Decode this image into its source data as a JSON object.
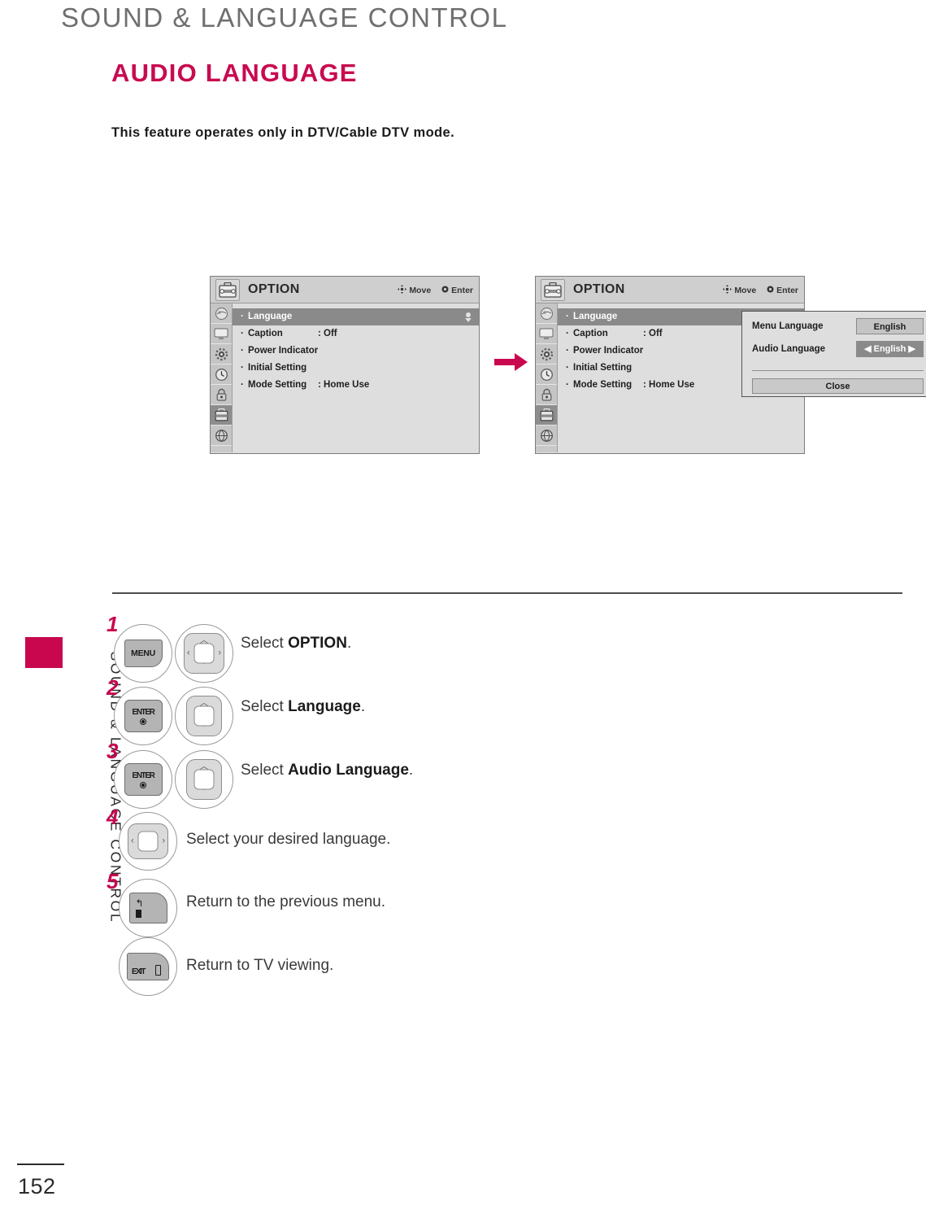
{
  "header": {
    "chapter_title": "SOUND & LANGUAGE CONTROL",
    "section_title": "AUDIO LANGUAGE",
    "intro": "This feature operates only in DTV/Cable DTV mode."
  },
  "side_tab": {
    "label": "SOUND & LANGUAGE CONTROL",
    "accent_color": "#c8074f"
  },
  "footer": {
    "page_number": "152"
  },
  "osd": {
    "title": "OPTION",
    "hints": {
      "move": "Move",
      "enter": "Enter"
    },
    "rail_icons": [
      "picture-icon",
      "screen-icon",
      "audio-gear-icon",
      "time-clock-icon",
      "lock-icon",
      "option-toolbox-icon",
      "network-globe-icon"
    ],
    "rail_active_index": 5,
    "menu_items": [
      {
        "label": "Language",
        "value": "",
        "selected": true,
        "scroll": true
      },
      {
        "label": "Caption",
        "value": ": Off",
        "selected": false,
        "scroll": false
      },
      {
        "label": "Power Indicator",
        "value": "",
        "selected": false,
        "scroll": false
      },
      {
        "label": "Initial Setting",
        "value": "",
        "selected": false,
        "scroll": false
      },
      {
        "label": "Mode Setting",
        "value": ": Home Use",
        "selected": false,
        "scroll": false
      }
    ],
    "bullet": "·"
  },
  "popup": {
    "rows": [
      {
        "label": "Menu Language",
        "value": "English",
        "active": false
      },
      {
        "label": "Audio Language",
        "value": "◀ English ▶",
        "active": true
      }
    ],
    "close_label": "Close"
  },
  "flow": {
    "arrow": "right-arrow-icon",
    "color": "#c8074f"
  },
  "steps": [
    {
      "number": "1",
      "keys": [
        "MENU",
        "nav-4way"
      ],
      "key_label": "MENU",
      "text_prefix": "Select ",
      "text_bold": "OPTION",
      "text_suffix": "."
    },
    {
      "number": "2",
      "keys": [
        "ENTER",
        "nav-updown"
      ],
      "key_label": "ENTER",
      "text_prefix": "Select ",
      "text_bold": "Language",
      "text_suffix": "."
    },
    {
      "number": "3",
      "keys": [
        "ENTER",
        "nav-updown"
      ],
      "key_label": "ENTER",
      "text_prefix": "Select ",
      "text_bold": "Audio Language",
      "text_suffix": "."
    },
    {
      "number": "4",
      "keys": [
        "nav-leftright"
      ],
      "key_label": "",
      "text_prefix": "Select your desired language.",
      "text_bold": "",
      "text_suffix": ""
    },
    {
      "number": "5",
      "keys": [
        "BACK"
      ],
      "key_label": "",
      "text_prefix": "Return to the previous menu.",
      "text_bold": "",
      "text_suffix": ""
    },
    {
      "number": "",
      "keys": [
        "EXIT"
      ],
      "key_label": "EXIT",
      "text_prefix": "Return to TV viewing.",
      "text_bold": "",
      "text_suffix": ""
    }
  ]
}
